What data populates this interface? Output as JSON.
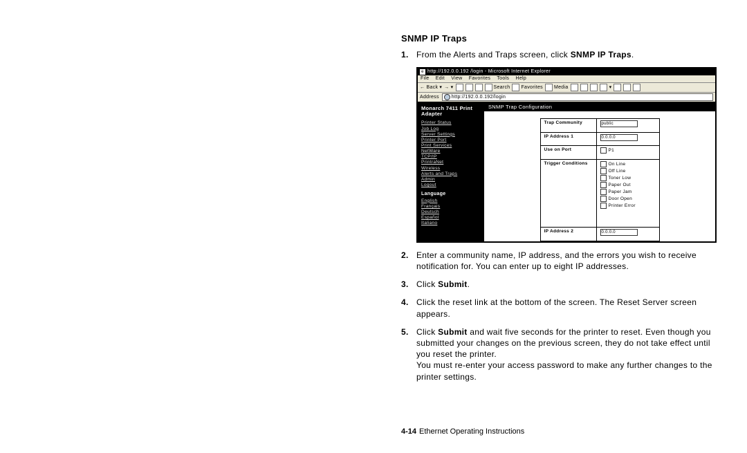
{
  "heading": "SNMP IP Traps",
  "steps": {
    "s1_pre": "From the Alerts and Traps screen, click ",
    "s1_bold": "SNMP IP Traps",
    "s1_post": ".",
    "s2": "Enter a community name, IP address, and the errors you wish to receive notification for. You can enter up to eight IP addresses.",
    "s3_pre": "Click ",
    "s3_bold": "Submit",
    "s3_post": ".",
    "s4": "Click the reset link at the bottom of the screen. The Reset Server screen appears.",
    "s5_pre": "Click ",
    "s5_bold": "Submit",
    "s5_mid": " and wait five seconds for the printer to reset. Even though you submitted your changes on the previous screen, they do not take effect until you reset the printer.",
    "s5_tail": "You must re-enter your access password to make any further changes to the printer settings."
  },
  "ie": {
    "title": "http://192.0.0.192 /login - Microsoft Internet Explorer",
    "menu": [
      "File",
      "Edit",
      "View",
      "Favorites",
      "Tools",
      "Help"
    ],
    "toolbar": {
      "back": "Back",
      "search": "Search",
      "favorites": "Favorites",
      "media": "Media"
    },
    "address_label": "Address",
    "address_value": "http://192.0.0.192/login"
  },
  "sidebar": {
    "brand": "Monarch 7411 Print Adapter",
    "links": [
      "Printer Status",
      "Job Log",
      "Server Settings",
      "Printer Port",
      "Print Services",
      "NetWare",
      "TCP/IP",
      "PrintraNet",
      "Wireless",
      "Alerts and Traps",
      "Admin",
      "Logout"
    ],
    "lang_label": "Language",
    "langs": [
      "English",
      "Français",
      "Deutsch",
      "Español",
      "Italiano"
    ]
  },
  "panel": {
    "banner": "SNMP Trap Configuration",
    "rows": {
      "trap_community_lbl": "Trap Community",
      "trap_community_val": "public",
      "ip1_lbl": "IP Address 1",
      "ip1_val": "0.0.0.0",
      "useport_lbl": "Use on Port",
      "useport_opt": "P1",
      "trigger_lbl": "Trigger Conditions",
      "triggers": [
        "On Line",
        "Off Line",
        "Toner Low",
        "Paper Out",
        "Paper Jam",
        "Door Open",
        "Printer Error"
      ],
      "ip2_lbl": "IP Address 2",
      "ip2_val": "0.0.0.0"
    }
  },
  "footer": {
    "page": "4-14",
    "title": "Ethernet Operating Instructions"
  }
}
